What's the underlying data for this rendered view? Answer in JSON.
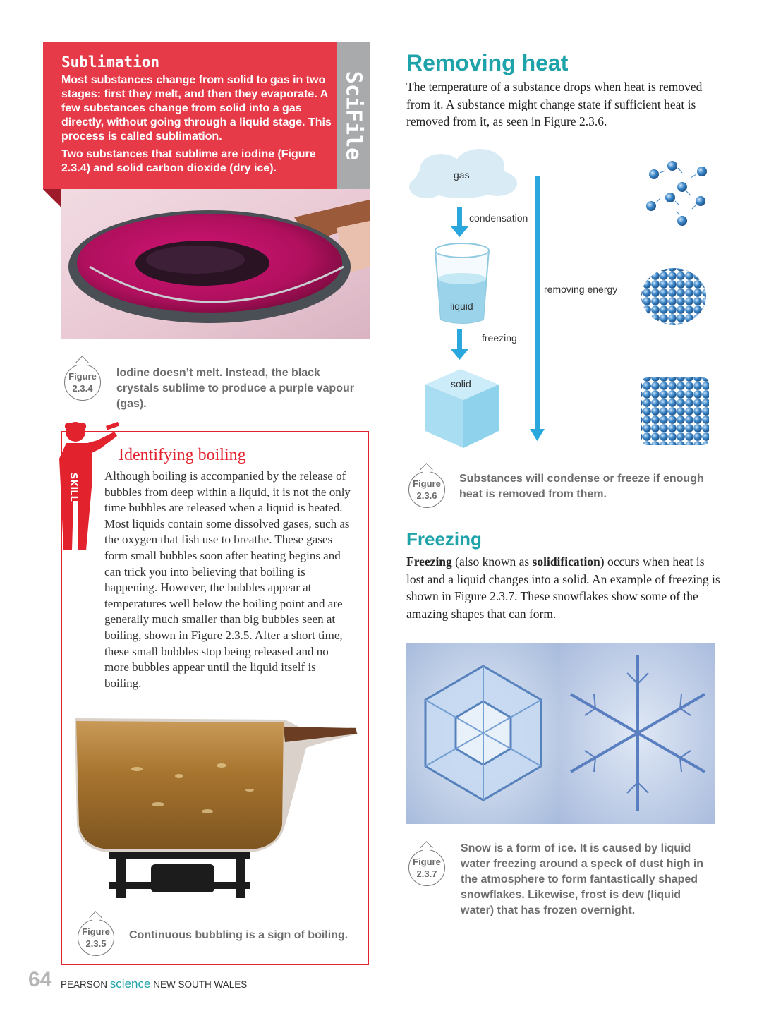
{
  "scifile": {
    "tab_label": "SciFile",
    "title": "Sublimation",
    "paragraph1": "Most substances change from solid to gas in two stages: first they melt, and then they evaporate. A few substances change from solid into a gas directly, without going through a liquid stage. This process is called sublimation.",
    "paragraph2": "Two substances that sublime are iodine (Figure 2.3.4) and solid carbon dioxide (dry ice)."
  },
  "figure_234": {
    "label": "Figure",
    "number": "2.3.4",
    "caption": "Iodine doesn’t melt. Instead, the black crystals sublime to produce a purple vapour (gas)."
  },
  "skills_lab": {
    "logo_text": "SKILL",
    "title": "Identifying boiling",
    "text": "Although boiling is accompanied by the release of bubbles from deep within a liquid, it is not the only time bubbles are released when a liquid is heated. Most liquids contain some dissolved gases, such as the oxygen that fish use to breathe. These gases form small bubbles soon after heating begins and can trick you into believing that boiling is happening. However, the bubbles appear at temperatures well below the boiling point and are generally much smaller than big bubbles seen at boiling, shown in Figure 2.3.5. After a short time, these small bubbles stop being released and no more bubbles appear until the liquid itself is boiling."
  },
  "figure_235": {
    "label": "Figure",
    "number": "2.3.5",
    "caption": "Continuous bubbling is a sign of boiling."
  },
  "removing_heat": {
    "title": "Removing heat",
    "text": "The temperature of a substance drops when heat is removed from it. A substance might change state if sufficient heat is removed from it, as seen in Figure 2.3.6."
  },
  "diagram": {
    "gas": "gas",
    "condensation": "condensation",
    "liquid": "liquid",
    "freezing": "freezing",
    "solid": "solid",
    "removing_energy": "removing energy",
    "colors": {
      "arrow": "#2aa8de",
      "particle": "#3a86c8"
    }
  },
  "figure_236": {
    "label": "Figure",
    "number": "2.3.6",
    "caption": "Substances will condense or freeze if enough heat is removed from them."
  },
  "freezing": {
    "title": "Freezing",
    "term1": "Freezing",
    "text_part1": " (also known as ",
    "term2": "solidification",
    "text_part2": ") occurs when heat is lost and a liquid changes into a solid. An example of freezing is shown in Figure 2.3.7. These snowflakes show some of the amazing shapes that can form."
  },
  "figure_237": {
    "label": "Figure",
    "number": "2.3.7",
    "caption": "Snow is a form of ice. It is caused by liquid water freezing around a speck of dust high in the atmosphere to form fantastically shaped snowflakes. Likewise, frost is dew (liquid water) that has frozen overnight."
  },
  "footer": {
    "page_number": "64",
    "publisher": "PEARSON",
    "brand": "science",
    "edition": "NEW SOUTH WALES",
    "brand_color": "#1fa3ab"
  }
}
